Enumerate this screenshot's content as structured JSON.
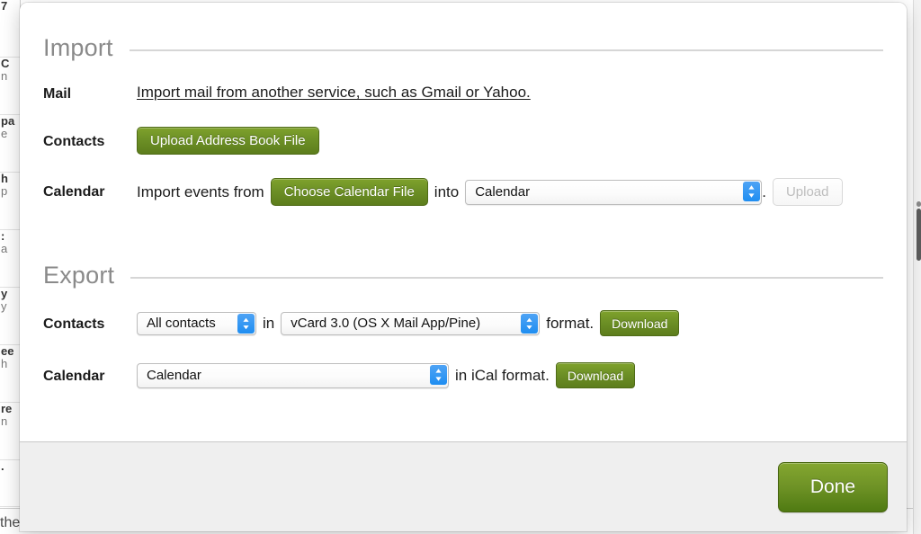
{
  "background": {
    "list_rows": [
      {
        "line1": "7",
        "line2": ""
      },
      {
        "line1": "C",
        "line2": "n"
      },
      {
        "line1": "pa",
        "line2": "e"
      },
      {
        "line1": "h",
        "line2": "p"
      },
      {
        "line1": ":",
        "line2": "a"
      },
      {
        "line1": "y",
        "line2": "y"
      },
      {
        "line1": "ee",
        "line2": "h"
      },
      {
        "line1": "re",
        "line2": "n"
      },
      {
        "line1": ".",
        "line2": ""
      }
    ],
    "bottom_preview": "the package you and Stella chose. I will at..."
  },
  "modal": {
    "sections": [
      {
        "id": "import",
        "title": "Import",
        "rows": [
          {
            "label": "Mail",
            "link_text": "Import mail from another service, such as Gmail or Yahoo."
          },
          {
            "label": "Contacts",
            "button_label": "Upload Address Book File"
          },
          {
            "label": "Calendar",
            "lead_text": "Import events from",
            "file_button_label": "Choose Calendar File",
            "mid_text": "into",
            "calendar_select_value": "Calendar",
            "trailing_text": ".",
            "upload_button_label": "Upload"
          }
        ]
      },
      {
        "id": "export",
        "title": "Export",
        "rows": [
          {
            "label": "Contacts",
            "scope_select_value": "All contacts",
            "mid_text_1": "in",
            "format_select_value": "vCard 3.0 (OS X Mail App/Pine)",
            "mid_text_2": "format.",
            "download_button_label": "Download"
          },
          {
            "label": "Calendar",
            "calendar_select_value": "Calendar",
            "mid_text": "in iCal format.",
            "download_button_label": "Download"
          }
        ]
      }
    ],
    "footer": {
      "done_label": "Done"
    }
  },
  "colors": {
    "green_button": "#6d9026",
    "green_button_dark": "#5d7d1c",
    "select_stepper_blue": "#1f8ef1",
    "heading_gray": "#8a8a8a",
    "footer_bg": "#efefef"
  }
}
